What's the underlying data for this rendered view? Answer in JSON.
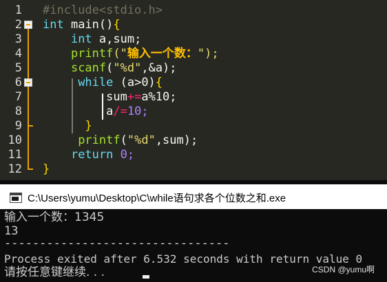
{
  "editor": {
    "line_numbers": [
      "1",
      "2",
      "3",
      "4",
      "5",
      "6",
      "7",
      "8",
      "9",
      "10",
      "11",
      "12"
    ],
    "code": {
      "l1_directive": "#include<stdio.h>",
      "l2_type": "int",
      "l2_name": " main()",
      "l2_brace": "{",
      "l3_type": "int",
      "l3_rest": " a,sum;",
      "l4_fn": "printf",
      "l4_open": "(\"",
      "l4_str": "输入一个数：",
      "l4_close": "\");",
      "l5_fn": "scanf",
      "l5_open": "(",
      "l5_str": "\"%d\"",
      "l5_rest": ",&a);",
      "l6_kw": "while",
      "l6_cond": " (a>0)",
      "l6_brace": "{",
      "l7_var": "sum",
      "l7_op": "+=",
      "l7_expr": "a%10;",
      "l8_var": "a",
      "l8_op": "/=",
      "l8_expr": "10;",
      "l9_brace": "}",
      "l10_fn": "printf",
      "l10_open": "(",
      "l10_str": "\"%d\"",
      "l10_rest": ",sum);",
      "l11_kw": "return",
      "l11_num": " 0;",
      "l12_brace": "}"
    }
  },
  "console": {
    "title": "C:\\Users\\yumu\\Desktop\\C\\while语句求各个位数之和.exe",
    "lines": [
      "输入一个数：1345",
      "13",
      "--------------------------------",
      "Process exited after 6.532 seconds with return value 0",
      "请按任意键继续. . ."
    ]
  },
  "watermark": "CSDN @yumu啊",
  "colors": {
    "editor_bg": "#272822",
    "keyword": "#66d9ef",
    "function": "#a6e22e",
    "string": "#e6db74",
    "fold_marker": "#e8a000",
    "console_bg": "#0c0c0c",
    "console_text": "#cccccc"
  },
  "icons": [
    "fold-collapse-icon",
    "console-app-icon"
  ]
}
